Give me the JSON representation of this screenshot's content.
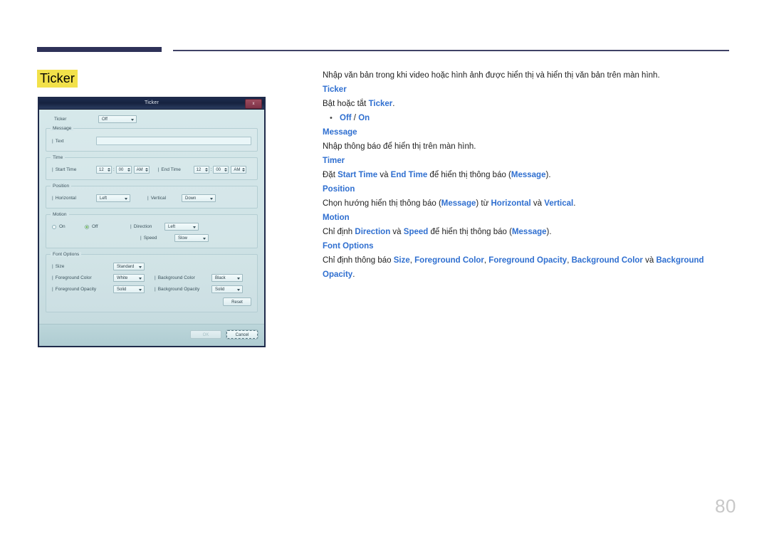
{
  "page": {
    "title": "Ticker",
    "number": "80",
    "accent_navy": "#2e3158",
    "highlight_yellow": "#f2e14a",
    "link_blue": "#2f6fd0"
  },
  "dialog": {
    "title": "Ticker",
    "close_label": "x",
    "ticker_row": {
      "label": "Ticker",
      "value": "Off"
    },
    "message_group": {
      "legend": "Message",
      "text_label": "Text",
      "text_value": "",
      "text_placeholder": ""
    },
    "time_group": {
      "legend": "Time",
      "start_label": "Start Time",
      "start_hour": "12",
      "start_minute": "00",
      "start_meridiem": "AM",
      "end_label": "End Time",
      "end_hour": "12",
      "end_minute": "00",
      "end_meridiem": "AM",
      "colon": ":"
    },
    "position_group": {
      "legend": "Position",
      "horizontal_label": "Horizontal",
      "horizontal_value": "Left",
      "vertical_label": "Vertical",
      "vertical_value": "Down"
    },
    "motion_group": {
      "legend": "Motion",
      "on_label": "On",
      "off_label": "Off",
      "selected": "Off",
      "direction_label": "Direction",
      "direction_value": "Left",
      "speed_label": "Speed",
      "speed_value": "Slow"
    },
    "font_options_group": {
      "legend": "Font Options",
      "size_label": "Size",
      "size_value": "Standard",
      "foreground_color_label": "Foreground Color",
      "foreground_color_value": "White",
      "background_color_label": "Background Color",
      "background_color_value": "Black",
      "foreground_opacity_label": "Foreground Opacity",
      "foreground_opacity_value": "Solid",
      "background_opacity_label": "Background Opacity",
      "background_opacity_value": "Solid",
      "reset_label": "Reset"
    },
    "footer": {
      "ok_label": "OK",
      "cancel_label": "Cancel"
    }
  },
  "content": {
    "intro": "Nhập văn bản trong khi video hoặc hình ảnh được hiển thị và hiển thị văn bản trên màn hình.",
    "ticker_heading": "Ticker",
    "ticker_desc_a": "Bật hoặc tắt ",
    "ticker_desc_kw": "Ticker",
    "ticker_desc_b": ".",
    "bullet_dot": "•",
    "bullet_off": "Off",
    "bullet_sep": " / ",
    "bullet_on": "On",
    "message_heading": "Message",
    "message_desc": "Nhập thông báo để hiển thị trên màn hình.",
    "timer_heading": "Timer",
    "timer_a": "Đặt ",
    "timer_kw1": "Start Time",
    "timer_b": " và ",
    "timer_kw2": "End Time",
    "timer_c": " để hiển thị thông báo (",
    "timer_kw3": "Message",
    "timer_d": ").",
    "position_heading": "Position",
    "position_a": "Chọn hướng hiển thị thông báo (",
    "position_kw1": "Message",
    "position_b": ") từ ",
    "position_kw2": "Horizontal",
    "position_c": " và ",
    "position_kw3": "Vertical",
    "position_d": ".",
    "motion_heading": "Motion",
    "motion_a": "Chỉ định ",
    "motion_kw1": "Direction",
    "motion_b": " và ",
    "motion_kw2": "Speed",
    "motion_c": " để hiển thị thông báo (",
    "motion_kw3": "Message",
    "motion_d": ").",
    "font_heading": "Font Options",
    "font_a": "Chỉ định thông báo ",
    "font_kw1": "Size",
    "font_b": ", ",
    "font_kw2": "Foreground Color",
    "font_c": ", ",
    "font_kw3": "Foreground Opacity",
    "font_d": ", ",
    "font_kw4": "Background Color",
    "font_e": " và ",
    "font_kw5": "Background Opacity",
    "font_f": "."
  }
}
